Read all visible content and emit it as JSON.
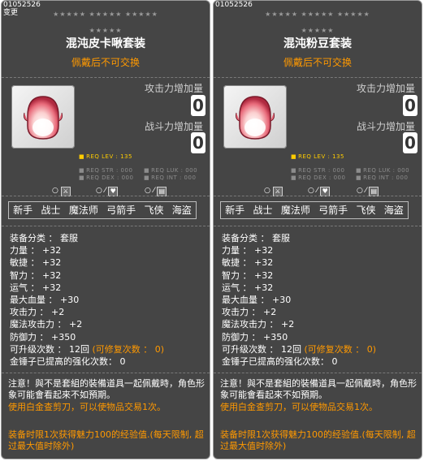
{
  "tooltips": [
    {
      "id_text": "01052526",
      "sub_text": "变更",
      "stars_row1": "★★★★★ ★★★★★ ★★★★★",
      "stars_row2": "★★★★★",
      "title": "混沌皮卡啾套装",
      "trade": "佩戴后不可交换",
      "attack_label": "攻击力增加量",
      "attack_value": "0",
      "power_label": "战斗力增加量",
      "power_value": "0",
      "req_lev": "REQ LEV : 135",
      "req_str": "REQ STR : 000",
      "req_luk": "REQ LUK : 000",
      "req_dex": "REQ DEX : 000",
      "req_int": "REQ INT : 000",
      "icon_stats": [
        "○",
        "○ ⁄",
        "○ ⁄"
      ],
      "jobs": [
        "新手",
        "战士",
        "魔法师",
        "弓箭手",
        "飞侠",
        "海盗"
      ],
      "stats": [
        "装备分类 ： 套服",
        "力量 ： +32",
        "敏捷 ： +32",
        "智力 ： +32",
        "运气 ： +32",
        "最大血量 ： +30",
        "攻击力 ： +2",
        "魔法攻击力 ： +2",
        "防御力 ： +350"
      ],
      "upgrade_text": "可升级次数 ： 12回",
      "upgrade_restore": "(可修复次数 ： 0)",
      "hammer_text": "金锤子已提高的强化次数： 0",
      "notice_text": "注意！與不是套組的裝備道具一起佩戴時，角色形象可能會看起來不如預期。",
      "scissors_text": "使用白金查剪刀，可以使物品交易1次。",
      "exp_text": "装备时限1次获得魅力100的经验值.(每天限制, 超过最大值时除外)"
    },
    {
      "id_text": "01052526",
      "sub_text": "",
      "stars_row1": "★★★★★ ★★★★★ ★★★★★",
      "stars_row2": "★★★★★",
      "title": "混沌粉豆套装",
      "trade": "佩戴后不可交换",
      "attack_label": "攻击力增加量",
      "attack_value": "0",
      "power_label": "战斗力增加量",
      "power_value": "0",
      "req_lev": "REQ LEV : 135",
      "req_str": "REQ STR : 000",
      "req_luk": "REQ LUK : 000",
      "req_dex": "REQ DEX : 000",
      "req_int": "REQ INT : 000",
      "icon_stats": [
        "○",
        "○ ⁄",
        "○ ⁄"
      ],
      "jobs": [
        "新手",
        "战士",
        "魔法师",
        "弓箭手",
        "飞侠",
        "海盗"
      ],
      "stats": [
        "装备分类 ： 套服",
        "力量 ： +32",
        "敏捷 ： +32",
        "智力 ： +32",
        "运气 ： +32",
        "最大血量 ： +30",
        "攻击力 ： +2",
        "魔法攻击力 ： +2",
        "防御力 ： +350"
      ],
      "upgrade_text": "可升级次数 ： 12回",
      "upgrade_restore": "(可修复次数 ： 0)",
      "hammer_text": "金锤子已提高的强化次数： 0",
      "notice_text": "注意！與不是套組的裝備道具一起佩戴時，角色形象可能會看起來不如預期。",
      "scissors_text": "使用白金查剪刀，可以使物品交易1次。",
      "exp_text": "装备时限1次获得魅力100的经验值.(每天限制, 超过最大值时除外)"
    }
  ],
  "icons": {
    "item": "pink-egg-outfit-icon",
    "job_icons": [
      "shield-sword-icon",
      "heart-icon",
      "scroll-icon"
    ]
  },
  "colors": {
    "panel": "#454545",
    "accent": "#ff9900",
    "req_active": "#ffcc00"
  }
}
